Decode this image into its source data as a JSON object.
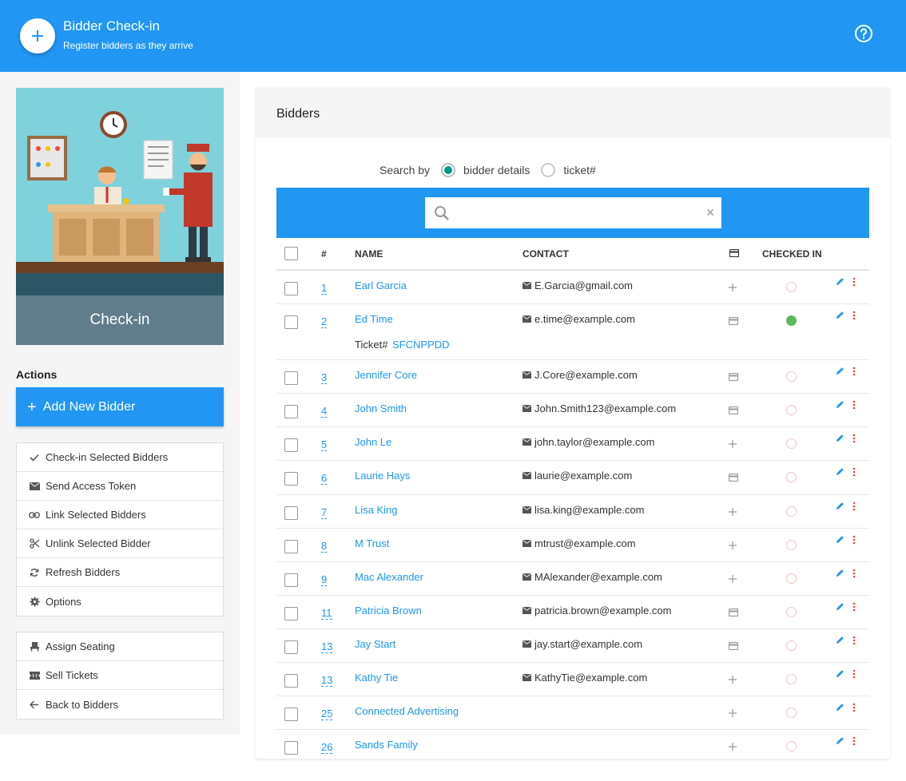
{
  "header": {
    "title": "Bidder Check-in",
    "subtitle": "Register bidders as they arrive"
  },
  "sidebar": {
    "hero_caption": "Check-in",
    "actions_heading": "Actions",
    "add_button": "Add New Bidder",
    "menu1": [
      {
        "label": "Check-in Selected Bidders",
        "icon": "check-icon"
      },
      {
        "label": "Send Access Token",
        "icon": "envelope-icon"
      },
      {
        "label": "Link Selected Bidders",
        "icon": "link-icon"
      },
      {
        "label": "Unlink Selected Bidder",
        "icon": "scissors-icon"
      },
      {
        "label": "Refresh Bidders",
        "icon": "refresh-icon"
      },
      {
        "label": "Options",
        "icon": "gear-icon"
      }
    ],
    "menu2": [
      {
        "label": "Assign Seating",
        "icon": "seat-icon"
      },
      {
        "label": "Sell Tickets",
        "icon": "ticket-icon"
      },
      {
        "label": "Back to Bidders",
        "icon": "arrow-left-icon"
      }
    ]
  },
  "panel": {
    "title": "Bidders",
    "search_by_label": "Search by",
    "option_details": "bidder details",
    "option_ticket": "ticket#",
    "search_value": "",
    "columns": {
      "num": "#",
      "name": "NAME",
      "contact": "CONTACT",
      "checked_in": "CHECKED IN"
    }
  },
  "rows": [
    {
      "num": "1",
      "name": "Earl Garcia",
      "email": "E.Garcia@gmail.com",
      "card": false,
      "checked_in": false
    },
    {
      "num": "2",
      "name": "Ed Time",
      "email": "e.time@example.com",
      "card": true,
      "checked_in": true,
      "ticket_label": "Ticket#",
      "ticket_code": "SFCNPPDD"
    },
    {
      "num": "3",
      "name": "Jennifer Core",
      "email": "J.Core@example.com",
      "card": true,
      "checked_in": false
    },
    {
      "num": "4",
      "name": "John Smith",
      "email": "John.Smith123@example.com",
      "card": true,
      "checked_in": false
    },
    {
      "num": "5",
      "name": "John Le",
      "email": "john.taylor@example.com",
      "card": false,
      "checked_in": false
    },
    {
      "num": "6",
      "name": "Laurie Hays",
      "email": "laurie@example.com",
      "card": true,
      "checked_in": false
    },
    {
      "num": "7",
      "name": "Lisa King",
      "email": "lisa.king@example.com",
      "card": false,
      "checked_in": false
    },
    {
      "num": "8",
      "name": "M Trust",
      "email": "mtrust@example.com",
      "card": false,
      "checked_in": false
    },
    {
      "num": "9",
      "name": "Mac Alexander",
      "email": "MAlexander@example.com",
      "card": false,
      "checked_in": false
    },
    {
      "num": "11",
      "name": "Patricia Brown",
      "email": "patricia.brown@example.com",
      "card": true,
      "checked_in": false
    },
    {
      "num": "13",
      "name": "Jay Start",
      "email": "jay.start@example.com",
      "card": true,
      "checked_in": false
    },
    {
      "num": "13",
      "name": "Kathy Tie",
      "email": "KathyTie@example.com",
      "card": false,
      "checked_in": false
    },
    {
      "num": "25",
      "name": "Connected Advertising",
      "email": "",
      "card": false,
      "checked_in": false
    },
    {
      "num": "26",
      "name": "Sands Family",
      "email": "",
      "card": false,
      "checked_in": false
    }
  ],
  "colors": {
    "primary": "#2196f3",
    "checked": "#5cb85c",
    "radio": "#009688",
    "hero_caption": "#607d8b"
  }
}
